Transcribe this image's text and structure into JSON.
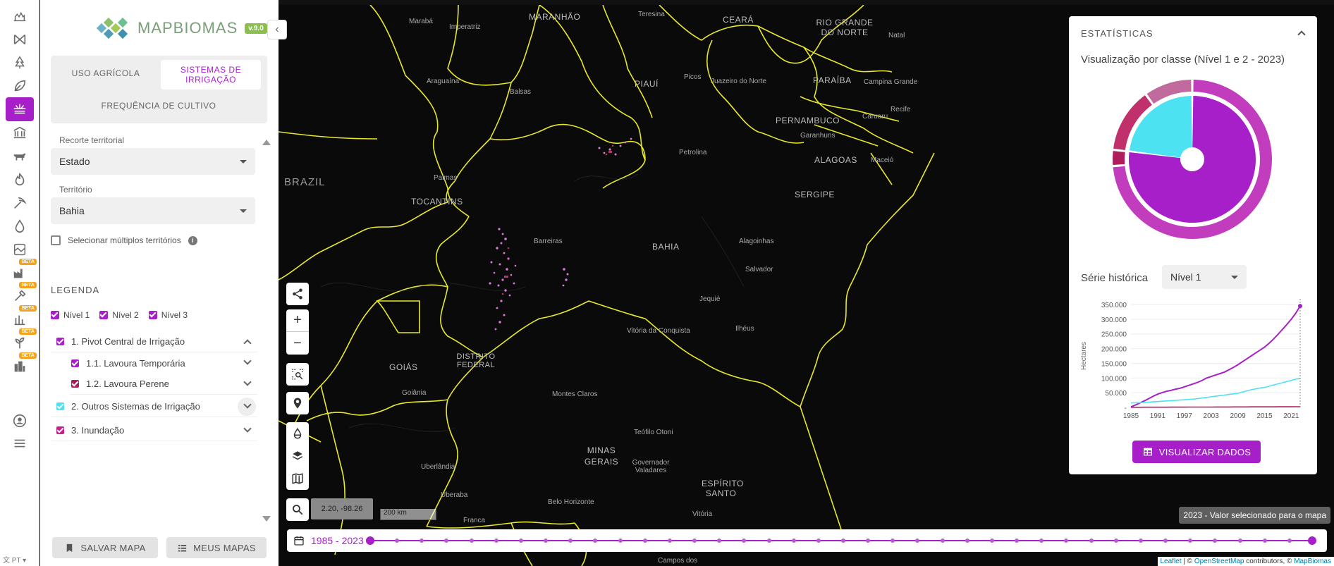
{
  "app": {
    "logo_text": "MAPBIOMAS",
    "version": "v.9.0"
  },
  "tabs": {
    "uso": "USO AGRÍCOLA",
    "sistemas": "SISTEMAS DE IRRIGAÇÃO",
    "frequencia": "FREQUÊNCIA DE CULTIVO"
  },
  "filters": {
    "recorte_label": "Recorte territorial",
    "recorte_value": "Estado",
    "territorio_label": "Território",
    "territorio_value": "Bahia",
    "multi_label": "Selecionar múltiplos territórios"
  },
  "legend": {
    "title": "LEGENDA",
    "levels": [
      "Nível 1",
      "Nível 2",
      "Nível 3"
    ],
    "items": [
      {
        "label": "1. Pivot Central de Irrigação",
        "color": "#a61fc9"
      },
      {
        "label": "1.1. Lavoura Temporária",
        "color": "#a61fc9"
      },
      {
        "label": "1.2. Lavoura Perene",
        "color": "#b01d5c"
      },
      {
        "label": "2. Outros Sistemas de Irrigação",
        "color": "#4de2f2"
      },
      {
        "label": "3. Inundação",
        "color": "#c51f8e"
      }
    ]
  },
  "buttons": {
    "save": "SALVAR MAPA",
    "my_maps": "MEUS MAPAS",
    "visualize": "VISUALIZAR DADOS"
  },
  "lang": "PT",
  "map": {
    "coords": "2.20, -98.26",
    "scale": "200 km",
    "timeline_range": "1985 - 2023",
    "tooltip": "2023 - Valor selecionado para o mapa",
    "attribution": {
      "leaflet": "Leaflet",
      "sep": " | © ",
      "osm": "OpenStreetMap",
      "contrib": " contributors, © ",
      "mb": "MapBiomas"
    },
    "labels": {
      "maranhao": "MARANHÃO",
      "ceara": "CEARÁ",
      "rn": "RIO GRANDE DO NORTE",
      "piaui": "PIAUÍ",
      "paraiba": "PARAÍBA",
      "pernambuco": "PERNAMBUCO",
      "alagoas": "ALAGOAS",
      "sergipe": "SERGIPE",
      "brazil": "BRAZIL",
      "tocantins": "TOCANTINS",
      "bahia": "BAHIA",
      "goias": "GOIÁS",
      "df": "DISTRITO FEDERAL",
      "minas": "MINAS GERAIS",
      "es": "ESPÍRITO SANTO"
    },
    "cities": {
      "maraba": "Marabá",
      "imperatriz": "Imperatriz",
      "teresina": "Teresina",
      "natal": "Natal",
      "araguaina": "Araguaína",
      "balsas": "Balsas",
      "picos": "Picos",
      "juazeiro": "Juazeiro do Norte",
      "campina": "Campina Grande",
      "recife": "Recife",
      "caruaru": "Caruaru",
      "garanhuns": "Garanhuns",
      "petrolina": "Petrolina",
      "maceio": "Maceió",
      "palmas": "Palmas",
      "barreiras": "Barreiras",
      "alagoinhas": "Alagoinhas",
      "salvador": "Salvador",
      "jequie": "Jequié",
      "vitoria_conquista": "Vitória da Conquista",
      "ilheus": "Ilhéus",
      "goiania": "Goiânia",
      "montes_claros": "Montes Claros",
      "teofilo": "Teófilo Otoni",
      "gov_valadares": "Governador Valadares",
      "uberlandia": "Uberlândia",
      "uberaba": "Uberaba",
      "belo_horizonte": "Belo Horizonte",
      "franca": "Franca",
      "vitoria": "Vitória",
      "campos": "Campos dos"
    }
  },
  "stats": {
    "title": "ESTATÍSTICAS",
    "subtitle": "Visualização por classe (Nível 1 e 2 - 2023)",
    "serie_label": "Série histórica",
    "serie_select": "Nível 1"
  },
  "chart_data": [
    {
      "type": "pie",
      "title": "Visualização por classe (Nível 1 e 2 - 2023)",
      "rings": [
        {
          "level": "inner",
          "slices": [
            {
              "name": "1. Pivot Central de Irrigação",
              "value": 0.77,
              "color": "#a61fc9"
            },
            {
              "name": "2. Outros Sistemas de Irrigação",
              "value": 0.23,
              "color": "#4de2f2"
            }
          ]
        },
        {
          "level": "outer",
          "slices": [
            {
              "name": "1.1. Lavoura Temporária",
              "value": 0.67,
              "color": "#c13dbd"
            },
            {
              "name": "1.2. Lavoura Perene",
              "value": 0.03,
              "color": "#b01d5c"
            },
            {
              "name": "2. Outros Sistemas de Irrigação",
              "value": 0.12,
              "color": "#c0306a"
            },
            {
              "name": "3. Inundação",
              "value": 0.09,
              "color": "#c06a9e"
            }
          ]
        }
      ]
    },
    {
      "type": "line",
      "ylabel": "Hectares",
      "ylim": [
        0,
        350000
      ],
      "yticks": [
        "350.000",
        "300.000",
        "250.000",
        "200.000",
        "150.000",
        "100.000",
        "50.000",
        "-"
      ],
      "xticks": [
        "1985",
        "1991",
        "1997",
        "2003",
        "2009",
        "2015",
        "2021"
      ],
      "x": [
        1985,
        1986,
        1987,
        1988,
        1989,
        1990,
        1991,
        1992,
        1993,
        1994,
        1995,
        1996,
        1997,
        1998,
        1999,
        2000,
        2001,
        2002,
        2003,
        2004,
        2005,
        2006,
        2007,
        2008,
        2009,
        2010,
        2011,
        2012,
        2013,
        2014,
        2015,
        2016,
        2017,
        2018,
        2019,
        2020,
        2021,
        2022,
        2023
      ],
      "series": [
        {
          "color": "#a61fc9",
          "values": [
            2000,
            8000,
            15000,
            22000,
            30000,
            38000,
            45000,
            50000,
            55000,
            58000,
            62000,
            65000,
            70000,
            75000,
            80000,
            85000,
            92000,
            100000,
            105000,
            110000,
            115000,
            120000,
            128000,
            136000,
            145000,
            155000,
            165000,
            175000,
            185000,
            195000,
            205000,
            218000,
            232000,
            248000,
            265000,
            282000,
            300000,
            320000,
            345000
          ]
        },
        {
          "color": "#4de2f2",
          "values": [
            15000,
            15500,
            16000,
            17000,
            18000,
            19000,
            20000,
            21000,
            22000,
            23000,
            24000,
            25000,
            26000,
            27000,
            28000,
            30000,
            32000,
            34000,
            36000,
            38000,
            40000,
            42000,
            44000,
            46000,
            48000,
            52000,
            56000,
            60000,
            63000,
            66000,
            68000,
            72000,
            76000,
            80000,
            84000,
            88000,
            92000,
            96000,
            98000
          ]
        },
        {
          "color": "#b01d5c",
          "values": [
            500,
            500,
            500,
            600,
            600,
            700,
            700,
            800,
            800,
            900,
            900,
            1000,
            1000,
            1100,
            1100,
            1200,
            1200,
            1300,
            1300,
            1400,
            1400,
            1500,
            1500,
            1600,
            1600,
            1700,
            1700,
            1800,
            1800,
            1900,
            1900,
            2000,
            2000,
            2100,
            2100,
            2200,
            2200,
            2300,
            2300
          ]
        }
      ]
    }
  ]
}
